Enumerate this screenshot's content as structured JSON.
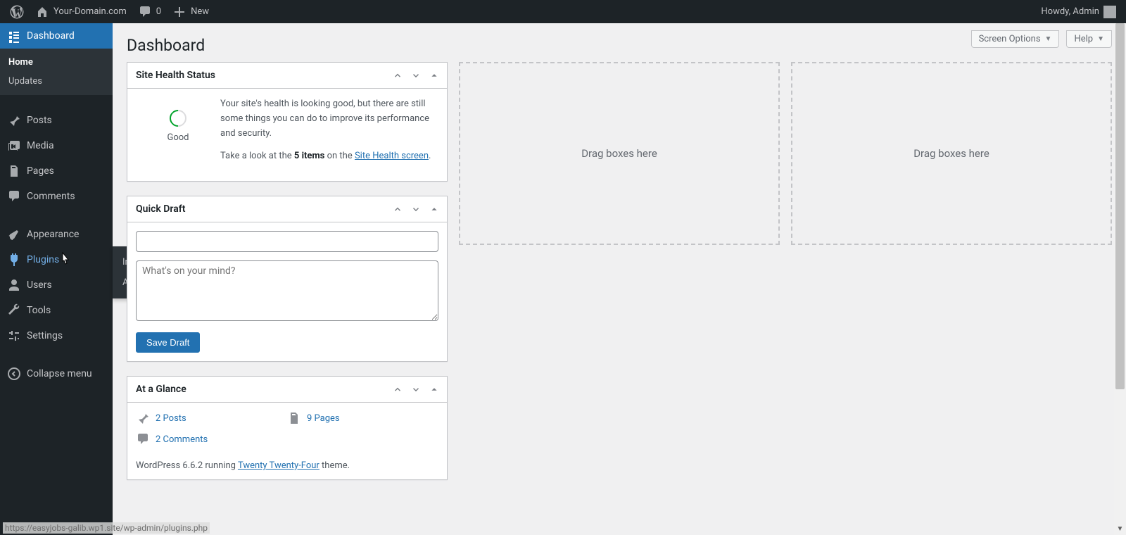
{
  "adminbar": {
    "site_name": "Your-Domain.com",
    "comments_count": "0",
    "new_label": "New",
    "howdy": "Howdy, Admin"
  },
  "sidebar": {
    "items": [
      {
        "label": "Dashboard"
      },
      {
        "label": "Posts"
      },
      {
        "label": "Media"
      },
      {
        "label": "Pages"
      },
      {
        "label": "Comments"
      },
      {
        "label": "Appearance"
      },
      {
        "label": "Plugins"
      },
      {
        "label": "Users"
      },
      {
        "label": "Tools"
      },
      {
        "label": "Settings"
      },
      {
        "label": "Collapse menu"
      }
    ],
    "dashboard_sub": {
      "home": "Home",
      "updates": "Updates"
    },
    "plugins_flyout": {
      "installed": "Installed Plugins",
      "add_new": "Add New Plugin"
    }
  },
  "page": {
    "title": "Dashboard",
    "screen_options": "Screen Options",
    "help": "Help"
  },
  "site_health": {
    "title": "Site Health Status",
    "status": "Good",
    "desc": "Your site's health is looking good, but there are still some things you can do to improve its performance and security.",
    "take_prefix": "Take a look at the ",
    "items_bold": "5 items",
    "on_the": " on the ",
    "link": "Site Health screen",
    "period": "."
  },
  "quick_draft": {
    "title": "Quick Draft",
    "content_placeholder": "What's on your mind?",
    "save": "Save Draft"
  },
  "at_glance": {
    "title": "At a Glance",
    "posts": "2 Posts",
    "pages": "9 Pages",
    "comments": "2 Comments",
    "wp_pre": "WordPress 6.6.2 running ",
    "theme": "Twenty Twenty-Four",
    "wp_post": " theme."
  },
  "drag_label": "Drag boxes here",
  "statusbar_url": "https://easyjobs-galib.wp1.site/wp-admin/plugins.php"
}
